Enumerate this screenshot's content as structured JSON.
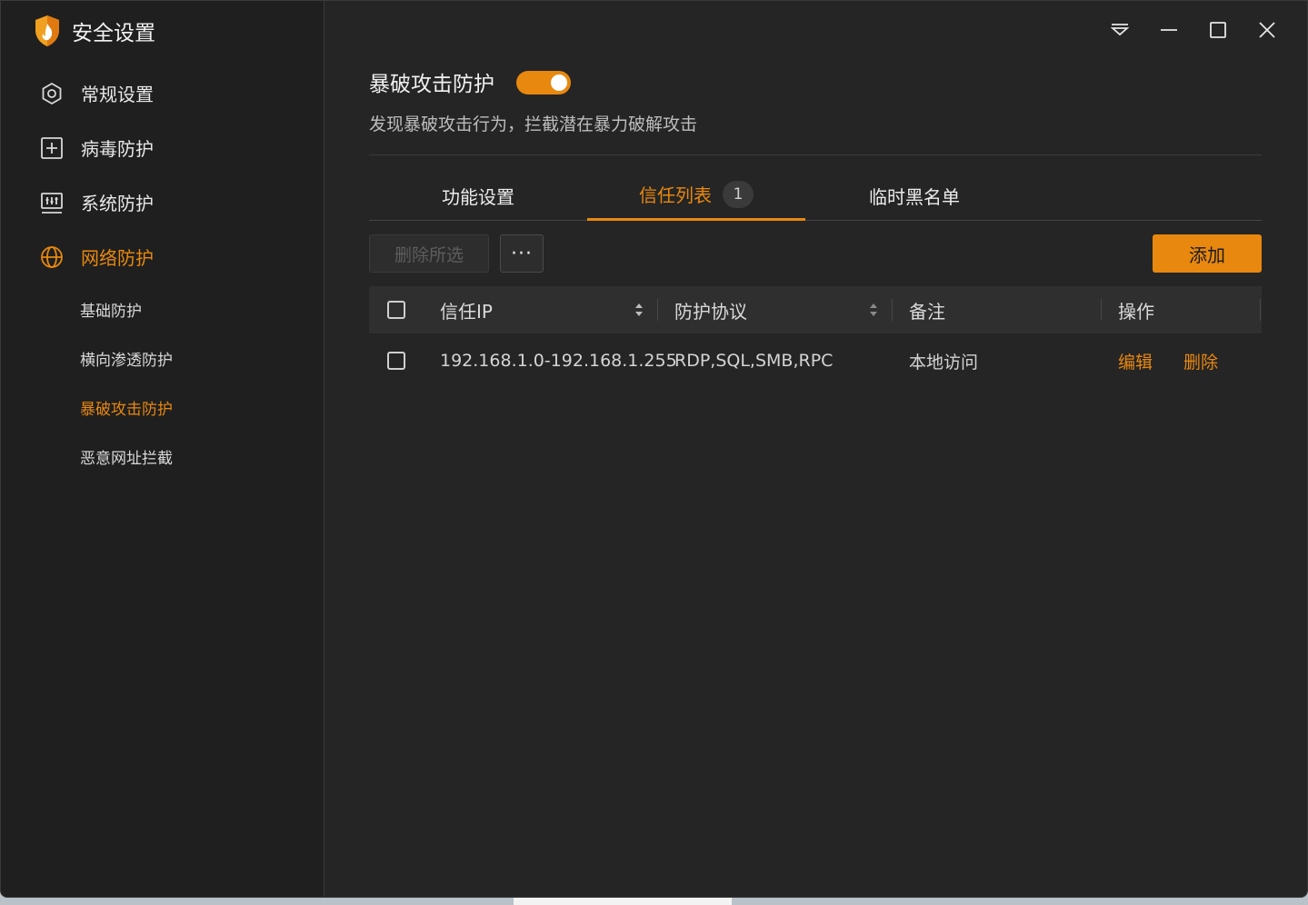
{
  "app": {
    "title": "安全设置"
  },
  "sidebar": {
    "items": [
      {
        "label": "常规设置",
        "icon": "gear-icon"
      },
      {
        "label": "病毒防护",
        "icon": "plus-box-icon"
      },
      {
        "label": "系统防护",
        "icon": "sliders-icon"
      },
      {
        "label": "网络防护",
        "icon": "globe-icon"
      }
    ],
    "subitems": [
      {
        "label": "基础防护"
      },
      {
        "label": "横向渗透防护"
      },
      {
        "label": "暴破攻击防护"
      },
      {
        "label": "恶意网址拦截"
      }
    ]
  },
  "main": {
    "title": "暴破攻击防护",
    "toggle_on": true,
    "description": "发现暴破攻击行为，拦截潜在暴力破解攻击",
    "tabs": [
      {
        "label": "功能设置"
      },
      {
        "label": "信任列表",
        "badge": "1"
      },
      {
        "label": "临时黑名单"
      }
    ],
    "toolbar": {
      "delete_selected": "删除所选",
      "more": "···",
      "add": "添加"
    },
    "table": {
      "columns": [
        "信任IP",
        "防护协议",
        "备注",
        "操作"
      ],
      "rows": [
        {
          "ip": "192.168.1.0-192.168.1.255",
          "protocols": "RDP,SQL,SMB,RPC",
          "note": "本地访问",
          "edit": "编辑",
          "delete": "删除"
        }
      ]
    }
  },
  "colors": {
    "accent": "#e8880f",
    "background": "#252525",
    "sidebar": "#1f1f1f"
  }
}
